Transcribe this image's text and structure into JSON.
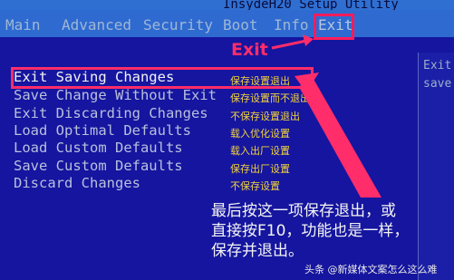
{
  "window_title": "InsydeH20 Setup Utility",
  "menu": [
    {
      "label": "Main"
    },
    {
      "label": "Advanced"
    },
    {
      "label": "Security"
    },
    {
      "label": "Boot"
    },
    {
      "label": "Info"
    },
    {
      "label": "Exit"
    }
  ],
  "annotation_exit": "Exit",
  "options": [
    {
      "label": "Exit Saving Changes",
      "cn": "保存设置退出"
    },
    {
      "label": "Save Change Without Exit",
      "cn": "保存设置而不退出"
    },
    {
      "label": "Exit Discarding Changes",
      "cn": "不保存设置退出"
    },
    {
      "label": "Load Optimal Defaults",
      "cn": "载入优化设置"
    },
    {
      "label": "Load Custom Defaults",
      "cn": "载入出厂设置"
    },
    {
      "label": "Save Custom Defaults",
      "cn": "保存出厂设置"
    },
    {
      "label": "Discard Changes",
      "cn": "不保存设置"
    }
  ],
  "right_panel": {
    "line1": "Exit",
    "line2": "save"
  },
  "note": {
    "line1": "最后按这一项保存退出，或",
    "line2": "直接按F10，功能也是一样，",
    "line3": "保存并退出。"
  },
  "watermark": "头条 @新媒体文案怎么这么难",
  "colors": {
    "annotation": "#ff2d6a",
    "background": "#15159f",
    "chinese_text": "#f3d43a"
  }
}
